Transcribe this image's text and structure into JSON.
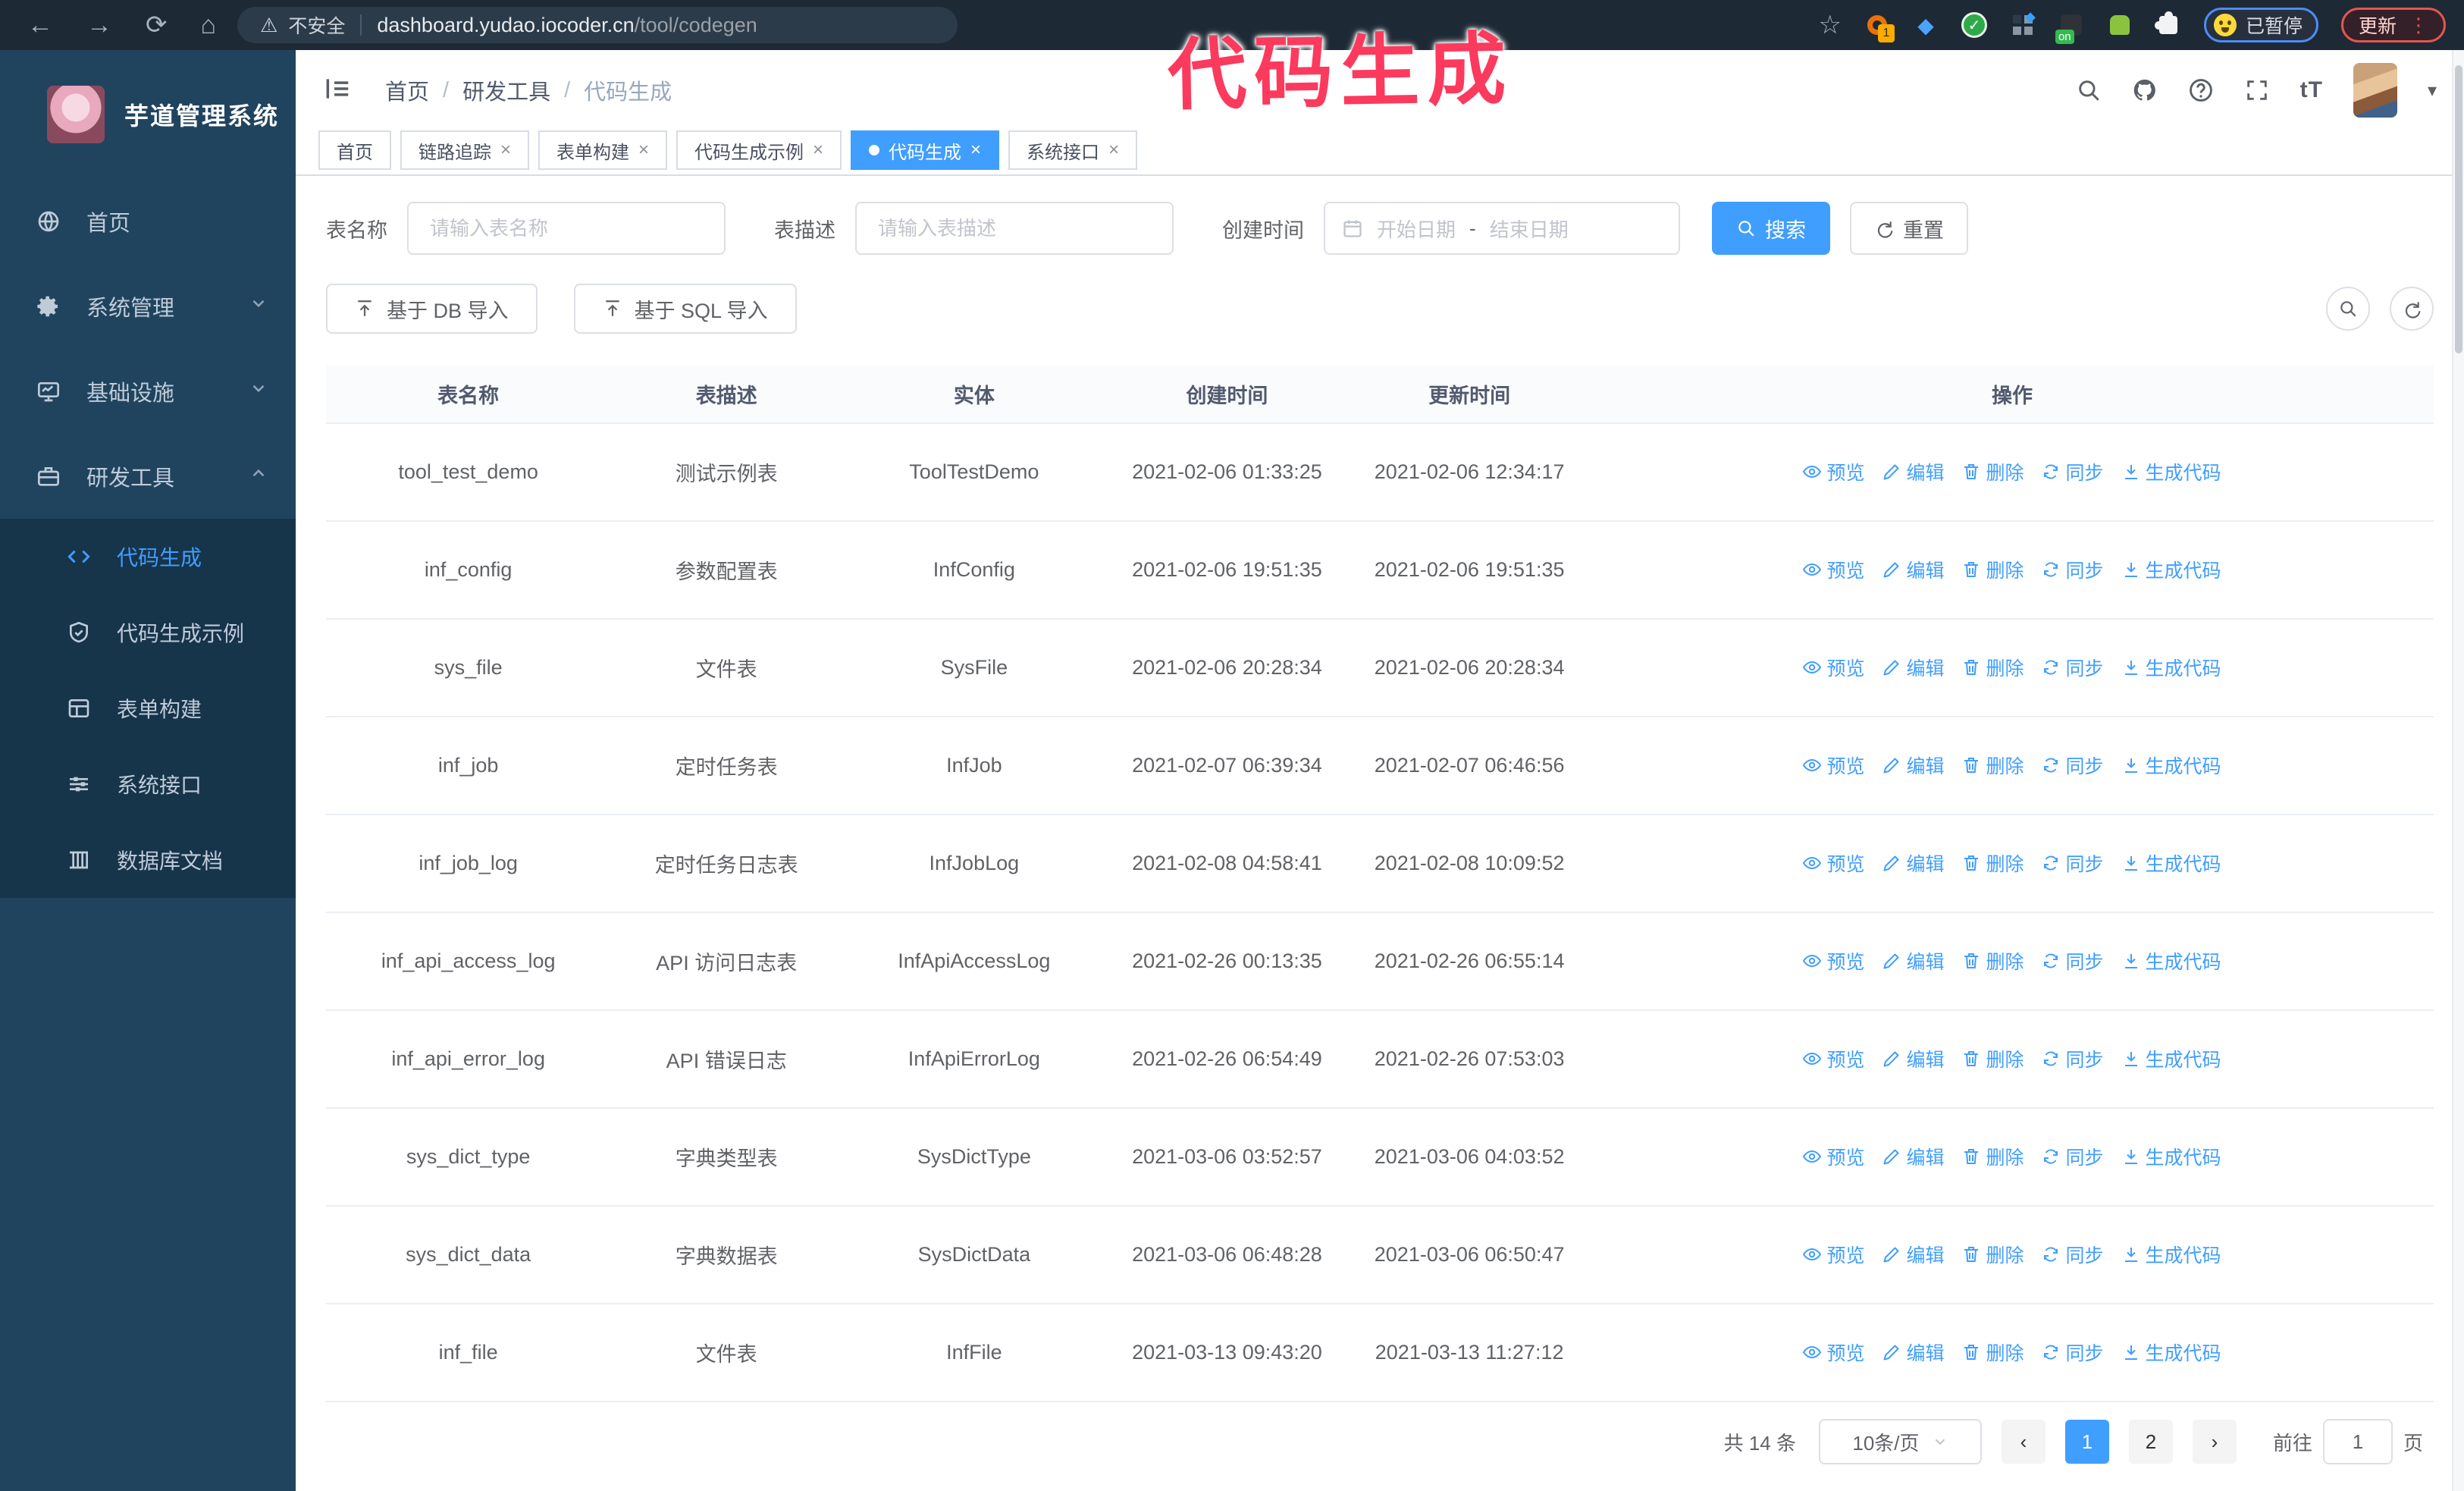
{
  "icons": {
    "back": "←",
    "forward": "→",
    "reload": "⟳",
    "home": "⌂",
    "star": "☆",
    "warning": "⚠",
    "menu_dots": "⋮",
    "caret_down": "▾",
    "close": "×",
    "prev": "‹",
    "next": "›",
    "check": "✓",
    "gem": "◆",
    "font_size": "tT"
  },
  "browser": {
    "security_warning": "不安全",
    "url_domain": "dashboard.yudao.iocoder.cn",
    "url_path": "/tool/codegen",
    "extension_badge_count": "1",
    "extension_on_label": "on",
    "paused_badge": "已暂停",
    "update_button": "更新"
  },
  "annotation": {
    "text": "代码生成",
    "color": "#fb3a5d"
  },
  "sidebar": {
    "title": "芋道管理系统",
    "items": [
      {
        "label": "首页"
      },
      {
        "label": "系统管理"
      },
      {
        "label": "基础设施"
      },
      {
        "label": "研发工具"
      }
    ],
    "subitems": [
      {
        "label": "代码生成"
      },
      {
        "label": "代码生成示例"
      },
      {
        "label": "表单构建"
      },
      {
        "label": "系统接口"
      },
      {
        "label": "数据库文档"
      }
    ]
  },
  "breadcrumb": {
    "home": "首页",
    "section": "研发工具",
    "current": "代码生成",
    "separator": "/"
  },
  "tabs": [
    {
      "label": "首页"
    },
    {
      "label": "链路追踪"
    },
    {
      "label": "表单构建"
    },
    {
      "label": "代码生成示例"
    },
    {
      "label": "代码生成"
    },
    {
      "label": "系统接口"
    }
  ],
  "filters": {
    "name_label": "表名称",
    "name_placeholder": "请输入表名称",
    "desc_label": "表描述",
    "desc_placeholder": "请输入表描述",
    "time_label": "创建时间",
    "start_placeholder": "开始日期",
    "range_separator": "-",
    "end_placeholder": "结束日期",
    "search": "搜索",
    "reset": "重置"
  },
  "toolbar": {
    "import_db": "基于 DB 导入",
    "import_sql": "基于 SQL 导入"
  },
  "table": {
    "columns": [
      "表名称",
      "表描述",
      "实体",
      "创建时间",
      "更新时间",
      "操作"
    ],
    "action_labels": [
      "预览",
      "编辑",
      "删除",
      "同步",
      "生成代码"
    ],
    "rows": [
      {
        "name": "tool_test_demo",
        "desc": "测试示例表",
        "entity": "ToolTestDemo",
        "created": "2021-02-06 01:33:25",
        "updated": "2021-02-06 12:34:17"
      },
      {
        "name": "inf_config",
        "desc": "参数配置表",
        "entity": "InfConfig",
        "created": "2021-02-06 19:51:35",
        "updated": "2021-02-06 19:51:35"
      },
      {
        "name": "sys_file",
        "desc": "文件表",
        "entity": "SysFile",
        "created": "2021-02-06 20:28:34",
        "updated": "2021-02-06 20:28:34"
      },
      {
        "name": "inf_job",
        "desc": "定时任务表",
        "entity": "InfJob",
        "created": "2021-02-07 06:39:34",
        "updated": "2021-02-07 06:46:56"
      },
      {
        "name": "inf_job_log",
        "desc": "定时任务日志表",
        "entity": "InfJobLog",
        "created": "2021-02-08 04:58:41",
        "updated": "2021-02-08 10:09:52"
      },
      {
        "name": "inf_api_access_log",
        "desc": "API 访问日志表",
        "entity": "InfApiAccessLog",
        "created": "2021-02-26 00:13:35",
        "updated": "2021-02-26 06:55:14"
      },
      {
        "name": "inf_api_error_log",
        "desc": "API 错误日志",
        "entity": "InfApiErrorLog",
        "created": "2021-02-26 06:54:49",
        "updated": "2021-02-26 07:53:03"
      },
      {
        "name": "sys_dict_type",
        "desc": "字典类型表",
        "entity": "SysDictType",
        "created": "2021-03-06 03:52:57",
        "updated": "2021-03-06 04:03:52"
      },
      {
        "name": "sys_dict_data",
        "desc": "字典数据表",
        "entity": "SysDictData",
        "created": "2021-03-06 06:48:28",
        "updated": "2021-03-06 06:50:47"
      },
      {
        "name": "inf_file",
        "desc": "文件表",
        "entity": "InfFile",
        "created": "2021-03-13 09:43:20",
        "updated": "2021-03-13 11:27:12"
      }
    ]
  },
  "pagination": {
    "total": "共 14 条",
    "page_size": "10条/页",
    "page_1": "1",
    "page_2": "2",
    "goto_label": "前往",
    "goto_value": "1",
    "goto_suffix": "页"
  }
}
